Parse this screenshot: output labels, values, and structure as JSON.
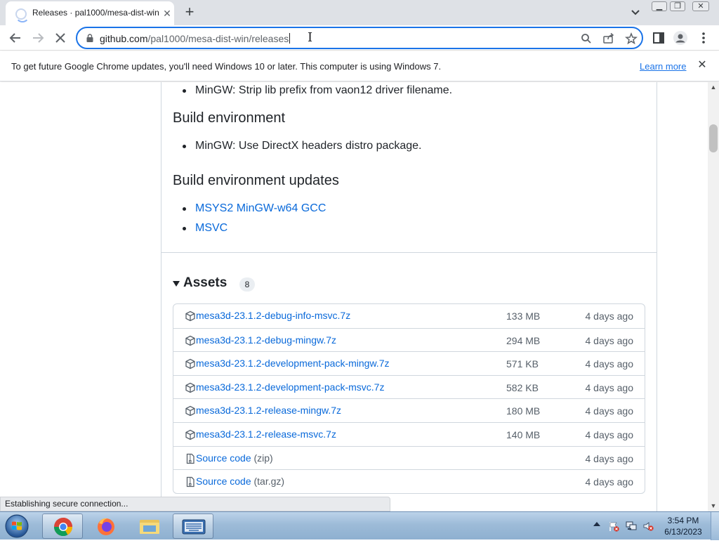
{
  "browser": {
    "tab": {
      "title": "Releases · pal1000/mesa-dist-win",
      "close_icon": "close-icon",
      "loading": true
    },
    "new_tab_icon": "plus-icon",
    "url": {
      "host": "github.com",
      "path": "/pal1000/mesa-dist-win/releases"
    },
    "infobar": {
      "message": "To get future Google Chrome updates, you'll need Windows 10 or later. This computer is using Windows 7.",
      "link": "Learn more"
    },
    "status": "Establishing secure connection..."
  },
  "content": {
    "prev_bullets": [
      "MinGW: Strip lib prefix from vaon12 driver filename."
    ],
    "build_env": {
      "heading": "Build environment",
      "items": [
        "MinGW: Use DirectX headers distro package."
      ]
    },
    "build_env_updates": {
      "heading": "Build environment updates",
      "items": [
        "MSYS2 MinGW-w64 GCC",
        "MSVC"
      ]
    },
    "assets": {
      "heading": "Assets",
      "count": "8",
      "rows": [
        {
          "name": "mesa3d-23.1.2-debug-info-msvc.7z",
          "suffix": "",
          "size": "133 MB",
          "date": "4 days ago",
          "icon": "package-icon"
        },
        {
          "name": "mesa3d-23.1.2-debug-mingw.7z",
          "suffix": "",
          "size": "294 MB",
          "date": "4 days ago",
          "icon": "package-icon"
        },
        {
          "name": "mesa3d-23.1.2-development-pack-mingw.7z",
          "suffix": "",
          "size": "571 KB",
          "date": "4 days ago",
          "icon": "package-icon"
        },
        {
          "name": "mesa3d-23.1.2-development-pack-msvc.7z",
          "suffix": "",
          "size": "582 KB",
          "date": "4 days ago",
          "icon": "package-icon"
        },
        {
          "name": "mesa3d-23.1.2-release-mingw.7z",
          "suffix": "",
          "size": "180 MB",
          "date": "4 days ago",
          "icon": "package-icon"
        },
        {
          "name": "mesa3d-23.1.2-release-msvc.7z",
          "suffix": "",
          "size": "140 MB",
          "date": "4 days ago",
          "icon": "package-icon"
        },
        {
          "name": "Source code",
          "suffix": " (zip)",
          "size": "",
          "date": "4 days ago",
          "icon": "file-zip-icon"
        },
        {
          "name": "Source code",
          "suffix": " (tar.gz)",
          "size": "",
          "date": "4 days ago",
          "icon": "file-zip-icon"
        }
      ]
    }
  },
  "taskbar": {
    "time": "3:54 PM",
    "date": "6/13/2023"
  },
  "colors": {
    "link": "#0969da",
    "chrome_focus": "#1a73e8",
    "taskbar": "#9dbbd8"
  }
}
